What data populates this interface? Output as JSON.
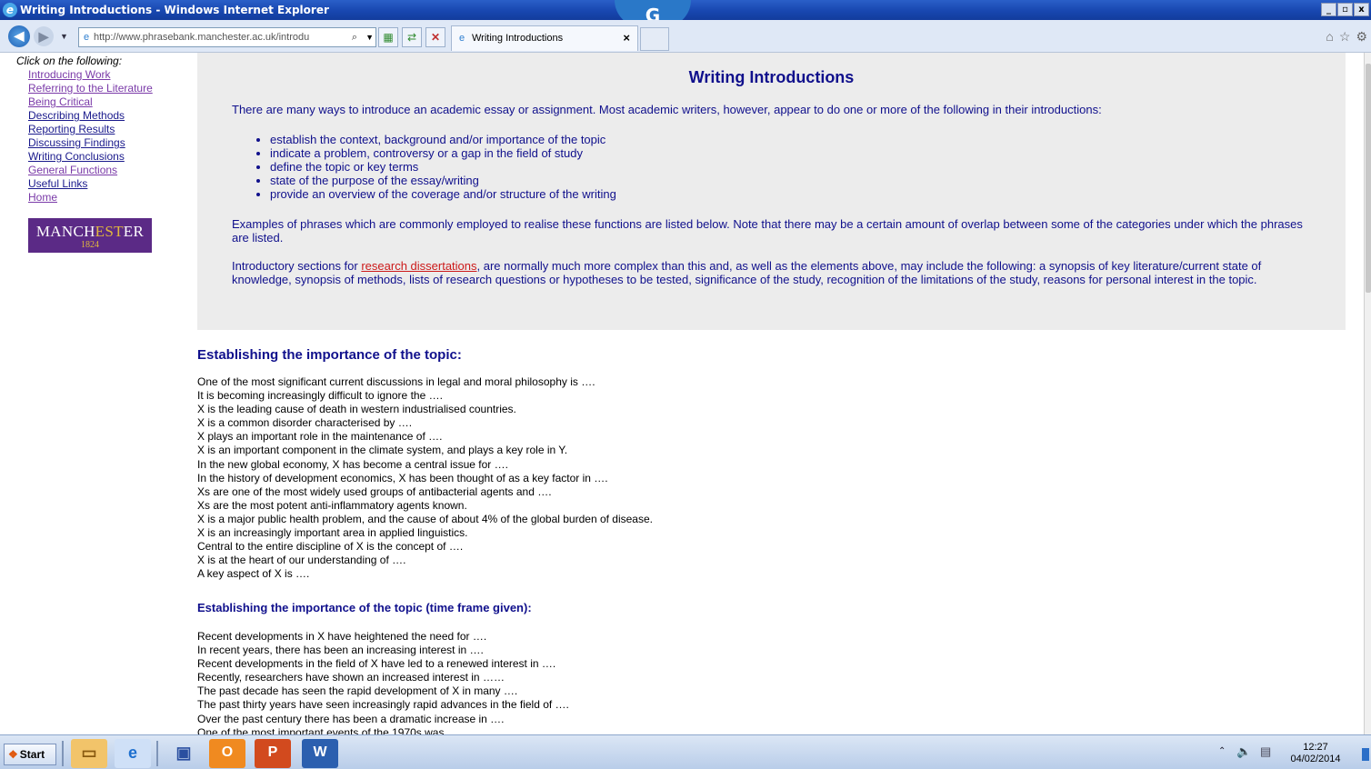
{
  "window": {
    "title": "Writing Introductions - Windows Internet Explorer",
    "g_badge": "G",
    "buttons": [
      "_",
      "▫",
      "x"
    ]
  },
  "address_bar": {
    "url": "http://www.phrasebank.manchester.ac.uk/introdu",
    "tab_title": "Writing Introductions",
    "tab_close": "×"
  },
  "sidebar": {
    "intro": "Click on the following:",
    "links": [
      {
        "label": "Introducing Work",
        "visited": true
      },
      {
        "label": "Referring to the Literature",
        "visited": true
      },
      {
        "label": "Being Critical",
        "visited": true
      },
      {
        "label": "Describing Methods",
        "visited": false
      },
      {
        "label": "Reporting Results",
        "visited": false
      },
      {
        "label": "Discussing Findings",
        "visited": false
      },
      {
        "label": "Writing Conclusions",
        "visited": false
      },
      {
        "label": "General Functions",
        "visited": true
      },
      {
        "label": "Useful Links",
        "visited": false
      },
      {
        "label": "Home",
        "visited": true
      }
    ],
    "logo": {
      "name_a": "MANCH",
      "name_b": "EST",
      "name_c": "ER",
      "year": "1824"
    }
  },
  "intro": {
    "heading": "Writing Introductions",
    "p1": "There are many ways to introduce an academic essay or assignment. Most academic writers, however, appear to do one or more of the following in their introductions:",
    "bullets": [
      "establish the context, background and/or importance of the topic",
      "indicate a problem, controversy or a gap in the field of study",
      "define the topic or key terms",
      "state of the purpose of the essay/writing",
      "provide an overview of the coverage and/or structure of the writing"
    ],
    "p2": "Examples of phrases which are commonly employed to realise these functions are listed below. Note that there may be a certain amount of overlap between some of the categories under which the phrases are listed.",
    "p3_before": "Introductory sections for ",
    "p3_link": "research dissertations",
    "p3_after": ", are normally much more complex than this and, as well as the elements above, may include the following: a synopsis of key literature/current state of knowledge, synopsis of methods, lists of research questions or hypotheses to be tested, significance of the study, recognition of the limitations of the study, reasons for personal interest in the topic."
  },
  "section1": {
    "heading": "Establishing the importance of the topic:",
    "phrases": [
      "One of the most significant current discussions in legal and moral philosophy is ….",
      "It is becoming increasingly difficult to ignore the ….",
      "X is the leading cause of death in western industrialised countries.",
      "X is a common disorder characterised by ….",
      "X plays an important role in the maintenance of ….",
      "X is an important component in the climate system, and plays a key role in Y.",
      "In the new global economy, X has become a central issue for ….",
      "In the history of development economics, X has been thought of as a key factor in ….",
      "Xs are one of the most widely used groups of antibacterial agents and ….",
      "Xs are the most potent anti-inflammatory agents known.",
      "X is a major public health problem, and the cause of about 4% of the global burden of disease.",
      "X is an increasingly important area in applied linguistics.",
      "Central to the entire discipline of X is the concept of ….",
      "X is at the heart of our understanding of ….",
      "A key aspect of X is …."
    ]
  },
  "section2": {
    "heading": "Establishing the importance of the topic (time frame given):",
    "phrases": [
      "Recent developments in X have heightened the need for ….",
      "In recent years, there has been an increasing interest in ….",
      "Recent developments in the field of X have led to a renewed interest in ….",
      "Recently, researchers have shown an increased interest in ……",
      "The past decade has seen the rapid development of X in many ….",
      "The past thirty years have seen increasingly rapid advances in the field of ….",
      "Over the past century there has been a dramatic increase in ….",
      "One of the most important events of the 1970s was"
    ]
  },
  "taskbar": {
    "start_label": "Start",
    "clock_time": "12:27",
    "clock_date": "04/02/2014"
  },
  "icons": [
    "ie-icon",
    "back-icon",
    "forward-icon",
    "page-icon",
    "search-icon",
    "compat-view-icon",
    "refresh-icon",
    "stop-icon",
    "home-icon",
    "favorites-icon",
    "tools-icon",
    "explorer-icon",
    "outlook-icon",
    "powerpoint-icon",
    "word-icon",
    "volume-icon",
    "network-icon"
  ]
}
